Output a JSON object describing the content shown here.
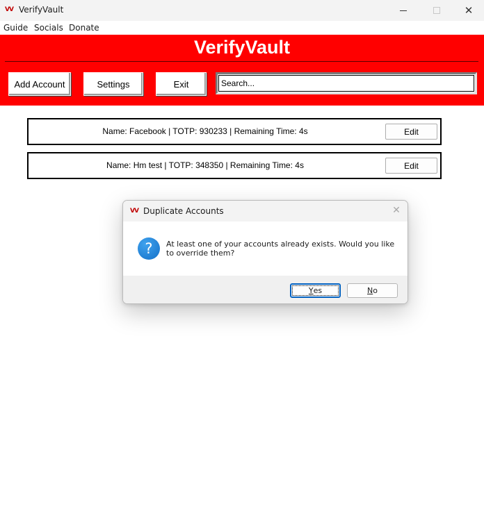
{
  "window": {
    "title": "VerifyVault",
    "logo_text": "VV",
    "controls": {
      "minimize": "minimize",
      "maximize": "maximize",
      "close": "✕"
    }
  },
  "menubar": {
    "items": [
      "Guide",
      "Socials",
      "Donate"
    ]
  },
  "header": {
    "brand": "VerifyVault",
    "background_color": "#ff0000",
    "buttons": {
      "add_account": "Add Account",
      "settings": "Settings",
      "exit": "Exit"
    },
    "search": {
      "value": "",
      "placeholder": "Search..."
    }
  },
  "accounts": [
    {
      "text": "Name: Facebook | TOTP: 930233 | Remaining Time: 4s",
      "edit_label": "Edit"
    },
    {
      "text": "Name: Hm test | TOTP: 348350 | Remaining Time: 4s",
      "edit_label": "Edit"
    }
  ],
  "dialog": {
    "title": "Duplicate Accounts",
    "logo_text": "VV",
    "icon": "question-icon",
    "icon_glyph": "?",
    "close_glyph": "✕",
    "message": "At least one of your accounts already exists. Would you like to override them?",
    "buttons": {
      "yes": {
        "mnemonic": "Y",
        "rest": "es"
      },
      "no": {
        "mnemonic": "N",
        "rest": "o"
      }
    }
  }
}
